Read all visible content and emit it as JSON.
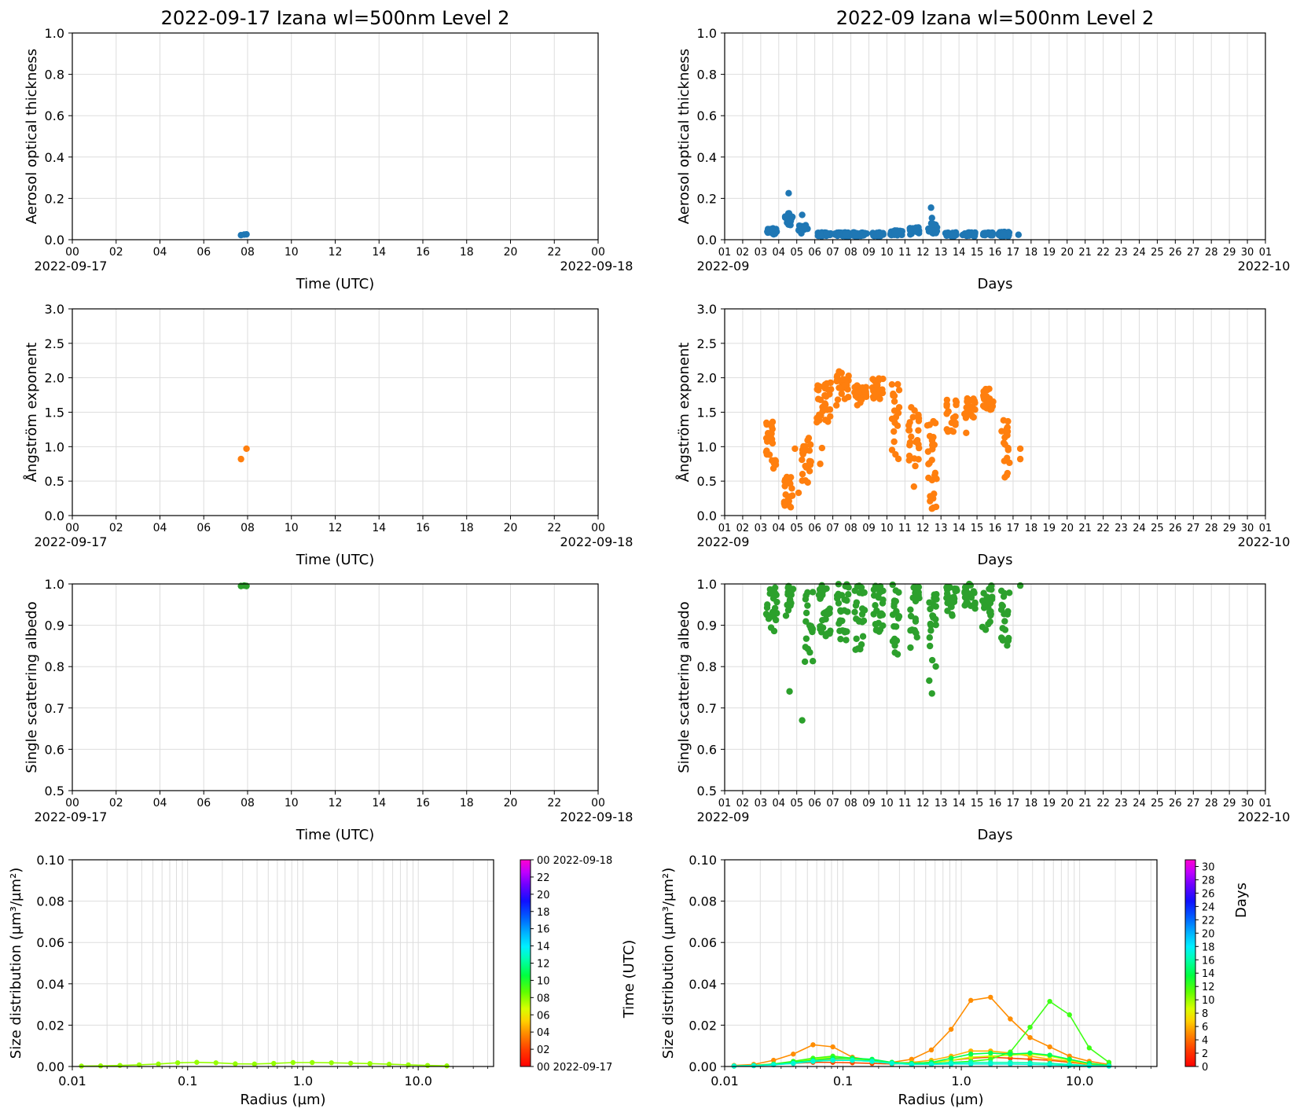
{
  "colors": {
    "aod": "#1f77b4",
    "angstrom": "#ff7f0e",
    "ssa": "#2ca02c",
    "grid": "#dddddd",
    "axis": "#000000"
  },
  "chart_data": [
    {
      "id": "aod-day",
      "type": "scatter",
      "title": "2022-09-17  Izana  wl=500nm  Level 2",
      "xlabel": "Time (UTC)",
      "ylabel": "Aerosol optical thickness",
      "xlim": [
        0,
        24
      ],
      "ylim": [
        0,
        1
      ],
      "xticks": [
        "00",
        "02",
        "04",
        "06",
        "08",
        "10",
        "12",
        "14",
        "16",
        "18",
        "20",
        "22",
        "00"
      ],
      "xdate_left": "2022-09-17",
      "xdate_right": "2022-09-18",
      "yticks": [
        "0.0",
        "0.2",
        "0.4",
        "0.6",
        "0.8",
        "1.0"
      ],
      "grid": true,
      "color": "aod",
      "points": [
        [
          7.7,
          0.022
        ],
        [
          7.85,
          0.025
        ],
        [
          7.95,
          0.026
        ]
      ]
    },
    {
      "id": "aod-month",
      "type": "scatter",
      "title": "2022-09  Izana  wl=500nm  Level 2",
      "xlabel": "Days",
      "ylabel": "Aerosol optical thickness",
      "xlim": [
        1,
        31
      ],
      "ylim": [
        0,
        1
      ],
      "xticks": [
        "01",
        "02",
        "03",
        "04",
        "05",
        "06",
        "07",
        "08",
        "09",
        "10",
        "11",
        "12",
        "13",
        "14",
        "15",
        "16",
        "17",
        "18",
        "19",
        "20",
        "21",
        "22",
        "23",
        "24",
        "25",
        "26",
        "27",
        "28",
        "29",
        "30",
        "01"
      ],
      "xdate_left": "2022-09",
      "xdate_right": "2022-10",
      "yticks": [
        "0.0",
        "0.2",
        "0.4",
        "0.6",
        "0.8",
        "1.0"
      ],
      "grid": true,
      "color": "aod",
      "clusters": [
        {
          "from": 3.3,
          "to": 3.9,
          "min": 0.02,
          "max": 0.055
        },
        {
          "from": 4.35,
          "to": 4.8,
          "min": 0.07,
          "max": 0.13
        },
        {
          "from": 5.1,
          "to": 5.6,
          "min": 0.03,
          "max": 0.07
        },
        {
          "from": 6.1,
          "to": 6.9,
          "min": 0.015,
          "max": 0.035
        },
        {
          "from": 7.1,
          "to": 7.9,
          "min": 0.015,
          "max": 0.035
        },
        {
          "from": 8.1,
          "to": 8.9,
          "min": 0.015,
          "max": 0.035
        },
        {
          "from": 9.2,
          "to": 9.8,
          "min": 0.015,
          "max": 0.035
        },
        {
          "from": 10.2,
          "to": 10.9,
          "min": 0.02,
          "max": 0.045
        },
        {
          "from": 11.2,
          "to": 11.8,
          "min": 0.025,
          "max": 0.06
        },
        {
          "from": 12.3,
          "to": 12.8,
          "min": 0.03,
          "max": 0.08
        },
        {
          "from": 13.2,
          "to": 13.9,
          "min": 0.015,
          "max": 0.035
        },
        {
          "from": 14.2,
          "to": 14.9,
          "min": 0.015,
          "max": 0.035
        },
        {
          "from": 15.3,
          "to": 15.9,
          "min": 0.02,
          "max": 0.035
        },
        {
          "from": 16.2,
          "to": 16.8,
          "min": 0.015,
          "max": 0.04
        }
      ],
      "points": [
        [
          4.55,
          0.225
        ],
        [
          5.3,
          0.12
        ],
        [
          12.45,
          0.155
        ],
        [
          12.5,
          0.105
        ],
        [
          17.3,
          0.024
        ]
      ]
    },
    {
      "id": "ang-day",
      "type": "scatter",
      "xlabel": "Time (UTC)",
      "ylabel": "Ångström exponent",
      "xlim": [
        0,
        24
      ],
      "ylim": [
        0,
        3
      ],
      "xticks": [
        "00",
        "02",
        "04",
        "06",
        "08",
        "10",
        "12",
        "14",
        "16",
        "18",
        "20",
        "22",
        "00"
      ],
      "xdate_left": "2022-09-17",
      "xdate_right": "2022-09-18",
      "yticks": [
        "0.0",
        "0.5",
        "1.0",
        "1.5",
        "2.0",
        "2.5",
        "3.0"
      ],
      "grid": true,
      "color": "angstrom",
      "points": [
        [
          7.7,
          0.82
        ],
        [
          7.95,
          0.97
        ]
      ]
    },
    {
      "id": "ang-month",
      "type": "scatter",
      "xlabel": "Days",
      "ylabel": "Ångström exponent",
      "xlim": [
        1,
        31
      ],
      "ylim": [
        0,
        3
      ],
      "xticks": [
        "01",
        "02",
        "03",
        "04",
        "05",
        "06",
        "07",
        "08",
        "09",
        "10",
        "11",
        "12",
        "13",
        "14",
        "15",
        "16",
        "17",
        "18",
        "19",
        "20",
        "21",
        "22",
        "23",
        "24",
        "25",
        "26",
        "27",
        "28",
        "29",
        "30",
        "01"
      ],
      "xdate_left": "2022-09",
      "xdate_right": "2022-10",
      "yticks": [
        "0.0",
        "0.5",
        "1.0",
        "1.5",
        "2.0",
        "2.5",
        "3.0"
      ],
      "grid": true,
      "color": "angstrom",
      "clusters": [
        {
          "from": 3.3,
          "to": 3.9,
          "min": 0.6,
          "max": 1.4
        },
        {
          "from": 4.3,
          "to": 4.8,
          "min": 0.12,
          "max": 0.6
        },
        {
          "from": 5.2,
          "to": 5.8,
          "min": 0.45,
          "max": 1.15
        },
        {
          "from": 6.1,
          "to": 6.9,
          "min": 1.3,
          "max": 1.95
        },
        {
          "from": 7.2,
          "to": 7.9,
          "min": 1.65,
          "max": 2.1
        },
        {
          "from": 8.2,
          "to": 8.9,
          "min": 1.6,
          "max": 1.9
        },
        {
          "from": 9.2,
          "to": 9.8,
          "min": 1.65,
          "max": 2.0
        },
        {
          "from": 10.2,
          "to": 10.7,
          "min": 0.7,
          "max": 2.05
        },
        {
          "from": 11.2,
          "to": 11.8,
          "min": 0.7,
          "max": 1.6
        },
        {
          "from": 12.2,
          "to": 12.8,
          "min": 0.1,
          "max": 1.4
        },
        {
          "from": 13.3,
          "to": 13.9,
          "min": 1.2,
          "max": 1.7
        },
        {
          "from": 14.3,
          "to": 14.9,
          "min": 1.4,
          "max": 1.7
        },
        {
          "from": 15.3,
          "to": 15.9,
          "min": 1.5,
          "max": 1.85
        },
        {
          "from": 16.3,
          "to": 16.8,
          "min": 0.55,
          "max": 1.45
        }
      ],
      "points": [
        [
          6.3,
          0.75
        ],
        [
          6.4,
          0.98
        ],
        [
          5.1,
          0.33
        ],
        [
          7.2,
          1.6
        ],
        [
          11.5,
          0.42
        ],
        [
          12.5,
          0.1
        ],
        [
          12.4,
          0.28
        ],
        [
          17.4,
          0.97
        ],
        [
          17.4,
          0.82
        ],
        [
          4.9,
          0.97
        ],
        [
          14.4,
          1.2
        ]
      ]
    },
    {
      "id": "ssa-day",
      "type": "scatter",
      "xlabel": "Time (UTC)",
      "ylabel": "Single scattering albedo",
      "xlim": [
        0,
        24
      ],
      "ylim": [
        0.5,
        1.0
      ],
      "xticks": [
        "00",
        "02",
        "04",
        "06",
        "08",
        "10",
        "12",
        "14",
        "16",
        "18",
        "20",
        "22",
        "00"
      ],
      "xdate_left": "2022-09-17",
      "xdate_right": "2022-09-18",
      "yticks": [
        "0.5",
        "0.6",
        "0.7",
        "0.8",
        "0.9",
        "1.0"
      ],
      "grid": true,
      "color": "ssa",
      "points": [
        [
          7.7,
          0.995
        ],
        [
          7.85,
          0.996
        ],
        [
          7.95,
          0.995
        ]
      ]
    },
    {
      "id": "ssa-month",
      "type": "scatter",
      "xlabel": "Days",
      "ylabel": "Single scattering albedo",
      "xlim": [
        1,
        31
      ],
      "ylim": [
        0.5,
        1.0
      ],
      "xticks": [
        "01",
        "02",
        "03",
        "04",
        "05",
        "06",
        "07",
        "08",
        "09",
        "10",
        "11",
        "12",
        "13",
        "14",
        "15",
        "16",
        "17",
        "18",
        "19",
        "20",
        "21",
        "22",
        "23",
        "24",
        "25",
        "26",
        "27",
        "28",
        "29",
        "30",
        "01"
      ],
      "xdate_left": "2022-09",
      "xdate_right": "2022-10",
      "yticks": [
        "0.5",
        "0.6",
        "0.7",
        "0.8",
        "0.9",
        "1.0"
      ],
      "grid": true,
      "color": "ssa",
      "clusters": [
        {
          "from": 3.3,
          "to": 3.9,
          "min": 0.88,
          "max": 1.0
        },
        {
          "from": 4.4,
          "to": 4.8,
          "min": 0.92,
          "max": 1.0
        },
        {
          "from": 5.4,
          "to": 5.9,
          "min": 0.81,
          "max": 1.0
        },
        {
          "from": 6.2,
          "to": 6.9,
          "min": 0.87,
          "max": 1.0
        },
        {
          "from": 7.2,
          "to": 7.9,
          "min": 0.86,
          "max": 1.0
        },
        {
          "from": 8.2,
          "to": 8.8,
          "min": 0.84,
          "max": 1.0
        },
        {
          "from": 9.2,
          "to": 9.8,
          "min": 0.88,
          "max": 1.0
        },
        {
          "from": 10.3,
          "to": 10.7,
          "min": 0.82,
          "max": 1.0
        },
        {
          "from": 11.3,
          "to": 11.8,
          "min": 0.82,
          "max": 1.0
        },
        {
          "from": 12.3,
          "to": 12.8,
          "min": 0.78,
          "max": 1.0
        },
        {
          "from": 13.3,
          "to": 13.9,
          "min": 0.92,
          "max": 1.0
        },
        {
          "from": 14.3,
          "to": 14.9,
          "min": 0.93,
          "max": 1.0
        },
        {
          "from": 15.3,
          "to": 15.9,
          "min": 0.87,
          "max": 1.0
        },
        {
          "from": 16.3,
          "to": 16.8,
          "min": 0.84,
          "max": 1.0
        }
      ],
      "points": [
        [
          4.6,
          0.74
        ],
        [
          5.3,
          0.67
        ],
        [
          12.5,
          0.735
        ],
        [
          12.35,
          0.766
        ],
        [
          17.4,
          0.996
        ]
      ]
    },
    {
      "id": "size-day",
      "type": "line",
      "xlabel": "Radius (µm)",
      "ylabel": "Size distribution (µm³/µm²)",
      "xscale": "log",
      "xlim": [
        0.01,
        45
      ],
      "ylim": [
        0,
        0.1
      ],
      "xticks": [
        "0.01",
        "0.1",
        "1.0",
        "10.0"
      ],
      "yticks": [
        "0.00",
        "0.02",
        "0.04",
        "0.06",
        "0.08",
        "0.10"
      ],
      "grid": true,
      "x": [
        0.012,
        0.0176,
        0.0259,
        0.038,
        0.0558,
        0.082,
        0.12,
        0.176,
        0.259,
        0.38,
        0.558,
        0.82,
        1.203,
        1.766,
        2.593,
        3.807,
        5.589,
        8.206,
        12.05,
        17.69
      ],
      "series": [
        {
          "value": 7.8,
          "values": [
            0.0002,
            0.0003,
            0.0005,
            0.0008,
            0.0012,
            0.0018,
            0.002,
            0.0018,
            0.0013,
            0.0012,
            0.0015,
            0.0019,
            0.0019,
            0.0018,
            0.0016,
            0.0014,
            0.0011,
            0.0008,
            0.0005,
            0.0003
          ]
        }
      ],
      "colorbar": {
        "label": "Time (UTC)",
        "range": [
          0,
          24
        ],
        "ticks": [
          {
            "v": 0,
            "t": "00 2022-09-17"
          },
          {
            "v": 2,
            "t": "02"
          },
          {
            "v": 4,
            "t": "04"
          },
          {
            "v": 6,
            "t": "06"
          },
          {
            "v": 8,
            "t": "08"
          },
          {
            "v": 10,
            "t": "10"
          },
          {
            "v": 12,
            "t": "12"
          },
          {
            "v": 14,
            "t": "14"
          },
          {
            "v": 16,
            "t": "16"
          },
          {
            "v": 18,
            "t": "18"
          },
          {
            "v": 20,
            "t": "20"
          },
          {
            "v": 22,
            "t": "22"
          },
          {
            "v": 24,
            "t": "00 2022-09-18"
          }
        ]
      }
    },
    {
      "id": "size-month",
      "type": "line",
      "xlabel": "Radius (µm)",
      "ylabel": "Size distribution (µm³/µm²)",
      "xscale": "log",
      "xlim": [
        0.01,
        45
      ],
      "ylim": [
        0,
        0.1
      ],
      "xticks": [
        "0.01",
        "0.1",
        "1.0",
        "10.0"
      ],
      "yticks": [
        "0.00",
        "0.02",
        "0.04",
        "0.06",
        "0.08",
        "0.10"
      ],
      "grid": true,
      "x": [
        0.012,
        0.0176,
        0.0259,
        0.038,
        0.0558,
        0.082,
        0.12,
        0.176,
        0.259,
        0.38,
        0.558,
        0.82,
        1.203,
        1.766,
        2.593,
        3.807,
        5.589,
        8.206,
        12.05,
        17.69
      ],
      "series": [
        {
          "value": 3,
          "values": [
            0.0002,
            0.0005,
            0.001,
            0.0015,
            0.002,
            0.002,
            0.0018,
            0.0015,
            0.0012,
            0.0015,
            0.002,
            0.003,
            0.004,
            0.0045,
            0.004,
            0.0035,
            0.003,
            0.002,
            0.001,
            0.0005
          ]
        },
        {
          "value": 5,
          "values": [
            0.0005,
            0.001,
            0.003,
            0.006,
            0.0105,
            0.0095,
            0.0045,
            0.003,
            0.002,
            0.0035,
            0.008,
            0.018,
            0.032,
            0.0335,
            0.023,
            0.014,
            0.0095,
            0.005,
            0.0025,
            0.001
          ]
        },
        {
          "value": 6,
          "values": [
            0.0003,
            0.0006,
            0.0012,
            0.002,
            0.003,
            0.0035,
            0.003,
            0.0025,
            0.0015,
            0.002,
            0.003,
            0.005,
            0.0075,
            0.0075,
            0.0065,
            0.005,
            0.0035,
            0.0025,
            0.001,
            0.0005
          ]
        },
        {
          "value": 9,
          "values": [
            0.0002,
            0.0005,
            0.001,
            0.002,
            0.0035,
            0.0045,
            0.0035,
            0.0025,
            0.0015,
            0.0012,
            0.002,
            0.003,
            0.0045,
            0.005,
            0.0055,
            0.006,
            0.005,
            0.003,
            0.0015,
            0.0005
          ]
        },
        {
          "value": 12,
          "values": [
            0.0002,
            0.0005,
            0.0012,
            0.0025,
            0.004,
            0.005,
            0.004,
            0.003,
            0.002,
            0.0015,
            0.0015,
            0.002,
            0.0025,
            0.0035,
            0.007,
            0.019,
            0.0315,
            0.025,
            0.009,
            0.002
          ]
        },
        {
          "value": 14,
          "values": [
            0.0002,
            0.0005,
            0.001,
            0.002,
            0.003,
            0.004,
            0.004,
            0.0035,
            0.002,
            0.0015,
            0.002,
            0.004,
            0.006,
            0.0065,
            0.006,
            0.0065,
            0.0055,
            0.0035,
            0.0015,
            0.0005
          ]
        },
        {
          "value": 16,
          "values": [
            0.0002,
            0.0004,
            0.0009,
            0.0015,
            0.0025,
            0.003,
            0.003,
            0.0025,
            0.0015,
            0.001,
            0.0012,
            0.0018,
            0.002,
            0.002,
            0.002,
            0.0018,
            0.0015,
            0.001,
            0.0005,
            0.0002
          ]
        },
        {
          "value": 17,
          "values": [
            0.0002,
            0.0004,
            0.0008,
            0.0015,
            0.0025,
            0.003,
            0.003,
            0.0025,
            0.0015,
            0.001,
            0.001,
            0.0012,
            0.0012,
            0.0012,
            0.0012,
            0.001,
            0.0008,
            0.0005,
            0.0003,
            0.0002
          ]
        }
      ],
      "colorbar": {
        "label": "Days",
        "range": [
          0,
          31
        ],
        "ticks": [
          {
            "v": 0,
            "t": "0"
          },
          {
            "v": 2,
            "t": "2"
          },
          {
            "v": 4,
            "t": "4"
          },
          {
            "v": 6,
            "t": "6"
          },
          {
            "v": 8,
            "t": "8"
          },
          {
            "v": 10,
            "t": "10"
          },
          {
            "v": 12,
            "t": "12"
          },
          {
            "v": 14,
            "t": "14"
          },
          {
            "v": 16,
            "t": "16"
          },
          {
            "v": 18,
            "t": "18"
          },
          {
            "v": 20,
            "t": "20"
          },
          {
            "v": 22,
            "t": "22"
          },
          {
            "v": 24,
            "t": "24"
          },
          {
            "v": 26,
            "t": "26"
          },
          {
            "v": 28,
            "t": "28"
          },
          {
            "v": 30,
            "t": "30"
          }
        ]
      }
    }
  ]
}
